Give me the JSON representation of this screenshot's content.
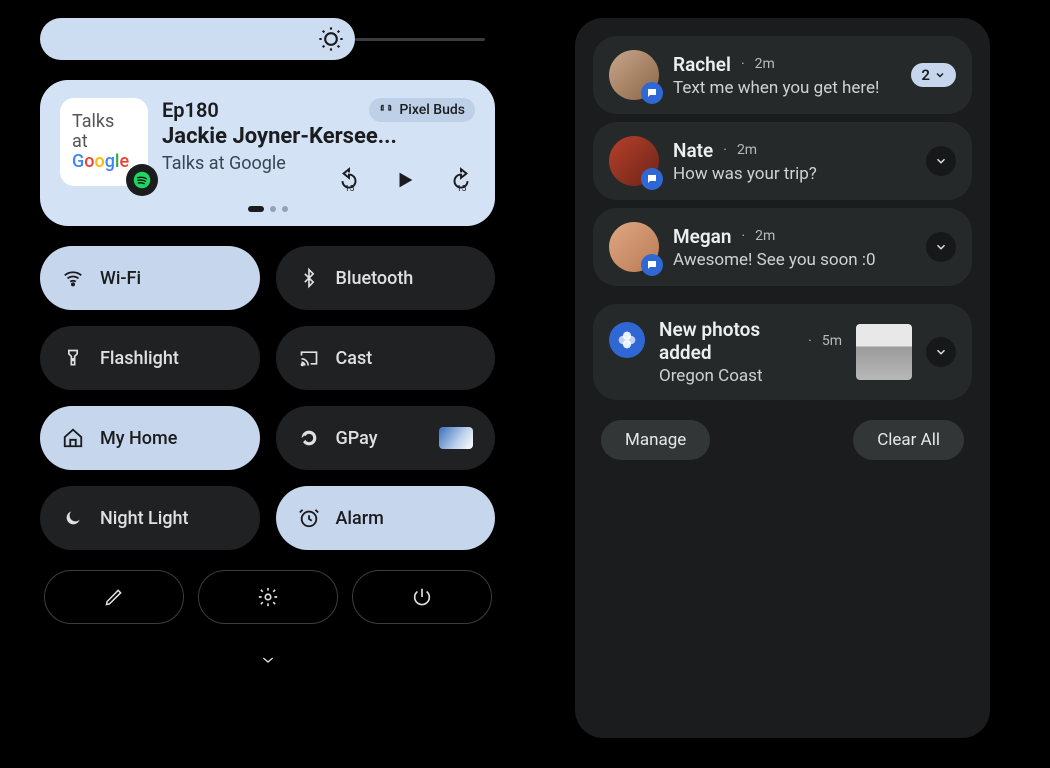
{
  "media": {
    "art_line1": "Talks",
    "art_line2": "at",
    "art_line3_letters": [
      "G",
      "o",
      "o",
      "g",
      "l",
      "e"
    ],
    "episode": "Ep180",
    "device_chip": "Pixel Buds",
    "track": "Jackie Joyner-Kersee...",
    "source": "Talks at Google"
  },
  "tiles": [
    {
      "label": "Wi-Fi",
      "style": "light",
      "icon": "wifi"
    },
    {
      "label": "Bluetooth",
      "style": "dark",
      "icon": "bluetooth"
    },
    {
      "label": "Flashlight",
      "style": "dark",
      "icon": "flashlight"
    },
    {
      "label": "Cast",
      "style": "dark",
      "icon": "cast"
    },
    {
      "label": "My Home",
      "style": "light",
      "icon": "home"
    },
    {
      "label": "GPay",
      "style": "dark",
      "icon": "gpay",
      "extra": true
    },
    {
      "label": "Night Light",
      "style": "dark",
      "icon": "moon"
    },
    {
      "label": "Alarm",
      "style": "light",
      "icon": "alarm"
    }
  ],
  "notifications": {
    "msgs": [
      {
        "name": "Rachel",
        "age": "2m",
        "body": "Text me when you get here!",
        "count": "2"
      },
      {
        "name": "Nate",
        "age": "2m",
        "body": "How was your trip?"
      },
      {
        "name": "Megan",
        "age": "2m",
        "body": "Awesome! See you soon :0"
      }
    ],
    "photos": {
      "title": "New photos added",
      "age": "5m",
      "body": "Oregon Coast"
    },
    "manage": "Manage",
    "clear": "Clear All"
  }
}
